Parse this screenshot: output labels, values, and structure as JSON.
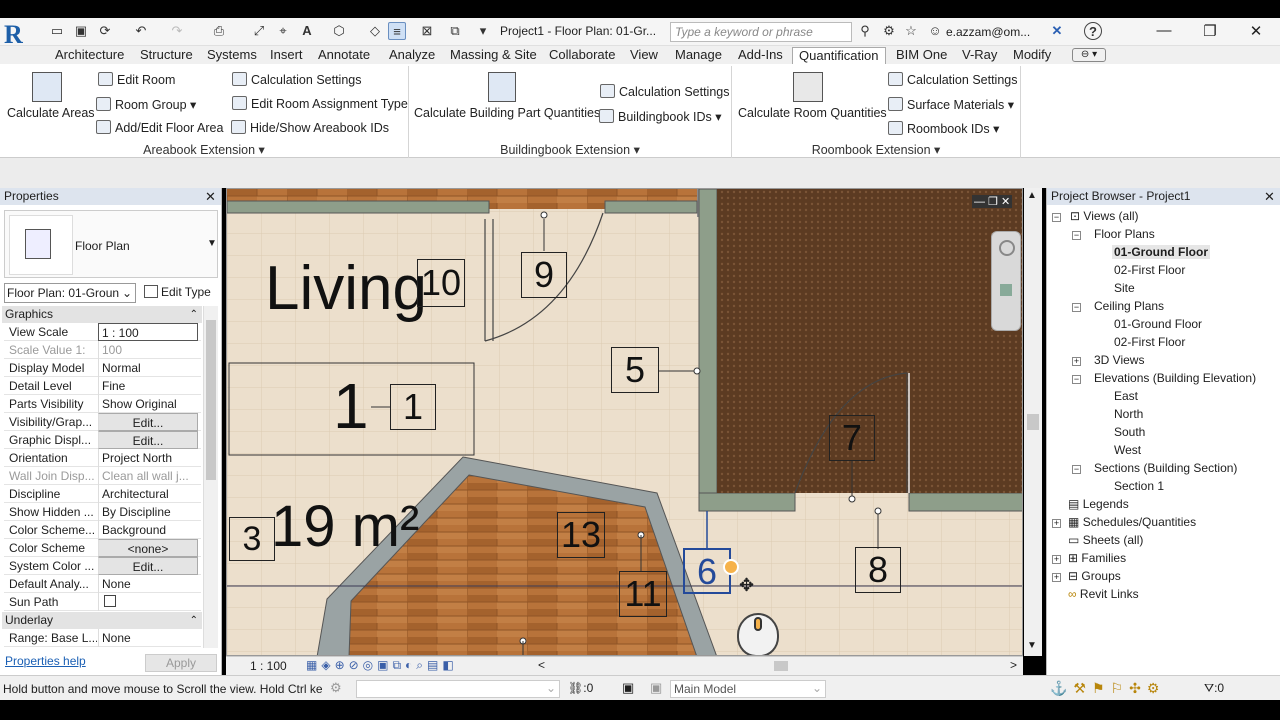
{
  "titlebar": {
    "logo": "R",
    "document_title": "Project1 - Floor Plan: 01-Gr...",
    "search_placeholder": "Type a keyword or phrase",
    "user": "e.azzam@om...",
    "help": "?"
  },
  "menu": {
    "tabs": [
      "Architecture",
      "Structure",
      "Systems",
      "Insert",
      "Annotate",
      "Analyze",
      "Massing & Site",
      "Collaborate",
      "View",
      "Manage",
      "Add-Ins",
      "Quantification",
      "BIM One",
      "V-Ray",
      "Modify"
    ],
    "active": "Quantification"
  },
  "ribbon": {
    "areabook": {
      "big": "Calculate Areas",
      "items": [
        "Edit Room",
        "Room Group",
        "Add/Edit Floor Area",
        "Calculation Settings",
        "Edit Room Assignment Type",
        "Hide/Show Areabook IDs"
      ],
      "title": "Areabook Extension"
    },
    "buildingbook": {
      "big": "Calculate Building Part Quantities",
      "items": [
        "Calculation Settings",
        "Buildingbook IDs"
      ],
      "title": "Buildingbook Extension"
    },
    "roombook": {
      "big": "Calculate Room Quantities",
      "items": [
        "Calculation Settings",
        "Surface Materials",
        "Roombook IDs"
      ],
      "title": "Roombook Extension"
    }
  },
  "properties": {
    "title": "Properties",
    "type_name": "Floor Plan",
    "instance_selector": "Floor Plan: 01-Groun",
    "edit_type": "Edit Type",
    "group_graphics": "Graphics",
    "group_underlay": "Underlay",
    "rows": [
      {
        "k": "View Scale",
        "v": "1 : 100"
      },
      {
        "k": "Scale Value    1:",
        "v": "100"
      },
      {
        "k": "Display Model",
        "v": "Normal"
      },
      {
        "k": "Detail Level",
        "v": "Fine"
      },
      {
        "k": "Parts Visibility",
        "v": "Show Original"
      },
      {
        "k": "Visibility/Grap...",
        "v": "Edit..."
      },
      {
        "k": "Graphic Displ...",
        "v": "Edit..."
      },
      {
        "k": "Orientation",
        "v": "Project North"
      },
      {
        "k": "Wall Join Disp...",
        "v": "Clean all wall j..."
      },
      {
        "k": "Discipline",
        "v": "Architectural"
      },
      {
        "k": "Show Hidden ...",
        "v": "By Discipline"
      },
      {
        "k": "Color Scheme...",
        "v": "Background"
      },
      {
        "k": "Color Scheme",
        "v": "<none>"
      },
      {
        "k": "System Color ...",
        "v": "Edit..."
      },
      {
        "k": "Default Analy...",
        "v": "None"
      },
      {
        "k": "Sun Path",
        "v": ""
      }
    ],
    "underlay_row": {
      "k": "Range: Base L...",
      "v": "None"
    },
    "help_link": "Properties help",
    "apply": "Apply"
  },
  "canvas": {
    "room_name": "Living",
    "room_area": "19 m²",
    "room_number": "1",
    "tags": [
      "10",
      "9",
      "5",
      "1",
      "7",
      "3",
      "13",
      "11",
      "6",
      "8"
    ],
    "scale": "1 : 100"
  },
  "browser": {
    "title": "Project Browser - Project1",
    "nodes": [
      {
        "label": "Views (all)",
        "level": 0,
        "toggle": "-"
      },
      {
        "label": "Floor Plans",
        "level": 1,
        "toggle": "-"
      },
      {
        "label": "01-Ground Floor",
        "level": 2,
        "bold": true
      },
      {
        "label": "02-First Floor",
        "level": 2
      },
      {
        "label": "Site",
        "level": 2
      },
      {
        "label": "Ceiling Plans",
        "level": 1,
        "toggle": "-"
      },
      {
        "label": "01-Ground Floor",
        "level": 2
      },
      {
        "label": "02-First Floor",
        "level": 2
      },
      {
        "label": "3D Views",
        "level": 1,
        "toggle": "+"
      },
      {
        "label": "Elevations (Building Elevation)",
        "level": 1,
        "toggle": "-"
      },
      {
        "label": "East",
        "level": 2
      },
      {
        "label": "North",
        "level": 2
      },
      {
        "label": "South",
        "level": 2
      },
      {
        "label": "West",
        "level": 2
      },
      {
        "label": "Sections (Building Section)",
        "level": 1,
        "toggle": "-"
      },
      {
        "label": "Section 1",
        "level": 2
      },
      {
        "label": "Legends",
        "level": 0
      },
      {
        "label": "Schedules/Quantities",
        "level": 0,
        "toggle": "+"
      },
      {
        "label": "Sheets (all)",
        "level": 0
      },
      {
        "label": "Families",
        "level": 0,
        "toggle": "+"
      },
      {
        "label": "Groups",
        "level": 0,
        "toggle": "+"
      },
      {
        "label": "Revit Links",
        "level": 0
      }
    ]
  },
  "status": {
    "message": "Hold button and move mouse to Scroll the view. Hold Ctrl ke",
    "selection_count": ":0",
    "model": "Main Model",
    "filter_count": ":0"
  }
}
